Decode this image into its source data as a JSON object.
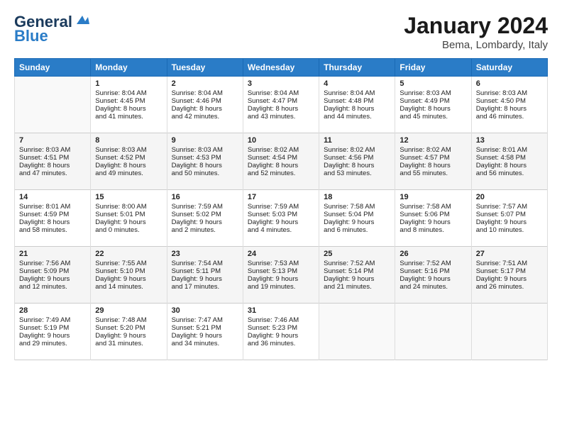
{
  "header": {
    "logo_general": "General",
    "logo_blue": "Blue",
    "month": "January 2024",
    "location": "Bema, Lombardy, Italy"
  },
  "columns": [
    "Sunday",
    "Monday",
    "Tuesday",
    "Wednesday",
    "Thursday",
    "Friday",
    "Saturday"
  ],
  "rows": [
    [
      {
        "day": "",
        "info": ""
      },
      {
        "day": "1",
        "info": "Sunrise: 8:04 AM\nSunset: 4:45 PM\nDaylight: 8 hours\nand 41 minutes."
      },
      {
        "day": "2",
        "info": "Sunrise: 8:04 AM\nSunset: 4:46 PM\nDaylight: 8 hours\nand 42 minutes."
      },
      {
        "day": "3",
        "info": "Sunrise: 8:04 AM\nSunset: 4:47 PM\nDaylight: 8 hours\nand 43 minutes."
      },
      {
        "day": "4",
        "info": "Sunrise: 8:04 AM\nSunset: 4:48 PM\nDaylight: 8 hours\nand 44 minutes."
      },
      {
        "day": "5",
        "info": "Sunrise: 8:03 AM\nSunset: 4:49 PM\nDaylight: 8 hours\nand 45 minutes."
      },
      {
        "day": "6",
        "info": "Sunrise: 8:03 AM\nSunset: 4:50 PM\nDaylight: 8 hours\nand 46 minutes."
      }
    ],
    [
      {
        "day": "7",
        "info": "Sunrise: 8:03 AM\nSunset: 4:51 PM\nDaylight: 8 hours\nand 47 minutes."
      },
      {
        "day": "8",
        "info": "Sunrise: 8:03 AM\nSunset: 4:52 PM\nDaylight: 8 hours\nand 49 minutes."
      },
      {
        "day": "9",
        "info": "Sunrise: 8:03 AM\nSunset: 4:53 PM\nDaylight: 8 hours\nand 50 minutes."
      },
      {
        "day": "10",
        "info": "Sunrise: 8:02 AM\nSunset: 4:54 PM\nDaylight: 8 hours\nand 52 minutes."
      },
      {
        "day": "11",
        "info": "Sunrise: 8:02 AM\nSunset: 4:56 PM\nDaylight: 8 hours\nand 53 minutes."
      },
      {
        "day": "12",
        "info": "Sunrise: 8:02 AM\nSunset: 4:57 PM\nDaylight: 8 hours\nand 55 minutes."
      },
      {
        "day": "13",
        "info": "Sunrise: 8:01 AM\nSunset: 4:58 PM\nDaylight: 8 hours\nand 56 minutes."
      }
    ],
    [
      {
        "day": "14",
        "info": "Sunrise: 8:01 AM\nSunset: 4:59 PM\nDaylight: 8 hours\nand 58 minutes."
      },
      {
        "day": "15",
        "info": "Sunrise: 8:00 AM\nSunset: 5:01 PM\nDaylight: 9 hours\nand 0 minutes."
      },
      {
        "day": "16",
        "info": "Sunrise: 7:59 AM\nSunset: 5:02 PM\nDaylight: 9 hours\nand 2 minutes."
      },
      {
        "day": "17",
        "info": "Sunrise: 7:59 AM\nSunset: 5:03 PM\nDaylight: 9 hours\nand 4 minutes."
      },
      {
        "day": "18",
        "info": "Sunrise: 7:58 AM\nSunset: 5:04 PM\nDaylight: 9 hours\nand 6 minutes."
      },
      {
        "day": "19",
        "info": "Sunrise: 7:58 AM\nSunset: 5:06 PM\nDaylight: 9 hours\nand 8 minutes."
      },
      {
        "day": "20",
        "info": "Sunrise: 7:57 AM\nSunset: 5:07 PM\nDaylight: 9 hours\nand 10 minutes."
      }
    ],
    [
      {
        "day": "21",
        "info": "Sunrise: 7:56 AM\nSunset: 5:09 PM\nDaylight: 9 hours\nand 12 minutes."
      },
      {
        "day": "22",
        "info": "Sunrise: 7:55 AM\nSunset: 5:10 PM\nDaylight: 9 hours\nand 14 minutes."
      },
      {
        "day": "23",
        "info": "Sunrise: 7:54 AM\nSunset: 5:11 PM\nDaylight: 9 hours\nand 17 minutes."
      },
      {
        "day": "24",
        "info": "Sunrise: 7:53 AM\nSunset: 5:13 PM\nDaylight: 9 hours\nand 19 minutes."
      },
      {
        "day": "25",
        "info": "Sunrise: 7:52 AM\nSunset: 5:14 PM\nDaylight: 9 hours\nand 21 minutes."
      },
      {
        "day": "26",
        "info": "Sunrise: 7:52 AM\nSunset: 5:16 PM\nDaylight: 9 hours\nand 24 minutes."
      },
      {
        "day": "27",
        "info": "Sunrise: 7:51 AM\nSunset: 5:17 PM\nDaylight: 9 hours\nand 26 minutes."
      }
    ],
    [
      {
        "day": "28",
        "info": "Sunrise: 7:49 AM\nSunset: 5:19 PM\nDaylight: 9 hours\nand 29 minutes."
      },
      {
        "day": "29",
        "info": "Sunrise: 7:48 AM\nSunset: 5:20 PM\nDaylight: 9 hours\nand 31 minutes."
      },
      {
        "day": "30",
        "info": "Sunrise: 7:47 AM\nSunset: 5:21 PM\nDaylight: 9 hours\nand 34 minutes."
      },
      {
        "day": "31",
        "info": "Sunrise: 7:46 AM\nSunset: 5:23 PM\nDaylight: 9 hours\nand 36 minutes."
      },
      {
        "day": "",
        "info": ""
      },
      {
        "day": "",
        "info": ""
      },
      {
        "day": "",
        "info": ""
      }
    ]
  ]
}
